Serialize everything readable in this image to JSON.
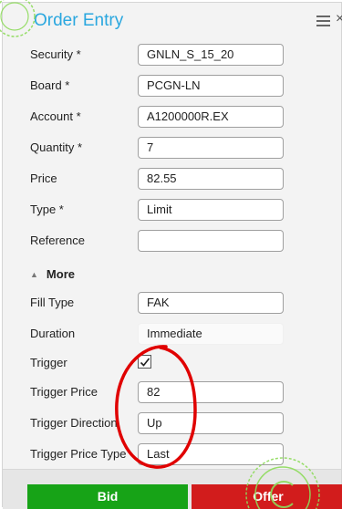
{
  "header": {
    "title": "Order Entry",
    "menu_icon": "hamburger-menu-icon",
    "close_label": "×"
  },
  "fields": [
    {
      "label": "Security *",
      "value": "GNLN_S_15_20"
    },
    {
      "label": "Board *",
      "value": "PCGN-LN"
    },
    {
      "label": "Account *",
      "value": "A1200000R.EX"
    },
    {
      "label": "Quantity *",
      "value": "7"
    },
    {
      "label": "Price",
      "value": "82.55"
    },
    {
      "label": "Type *",
      "value": "Limit"
    },
    {
      "label": "Reference",
      "value": ""
    }
  ],
  "more": {
    "label": "More",
    "caret": "▲"
  },
  "more_fields": {
    "fill_type": {
      "label": "Fill Type",
      "value": "FAK"
    },
    "duration": {
      "label": "Duration",
      "value": "Immediate"
    },
    "trigger": {
      "label": "Trigger",
      "checked": true
    },
    "trigger_price": {
      "label": "Trigger Price",
      "value": "82"
    },
    "trigger_direction": {
      "label": "Trigger Direction",
      "value": "Up"
    },
    "trigger_price_type": {
      "label": "Trigger Price Type",
      "value": "Last"
    }
  },
  "buttons": {
    "bid": "Bid",
    "offer": "Offer"
  },
  "colors": {
    "title": "#2aa7df",
    "bid": "#17a317",
    "offer": "#d21c1c",
    "annotation": "#e00000",
    "watermark": "#8ddb5a"
  }
}
